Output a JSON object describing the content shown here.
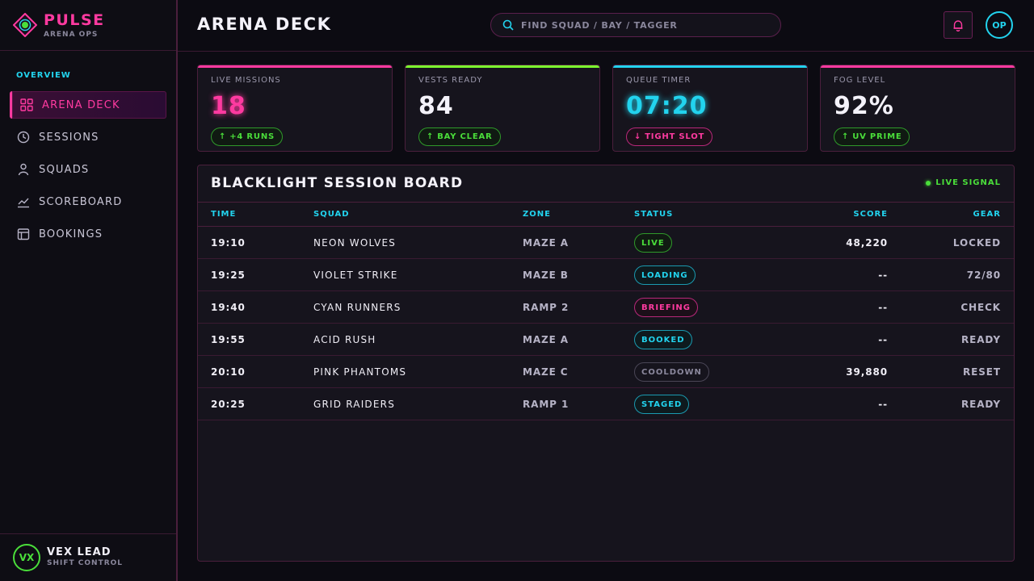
{
  "brand": {
    "name": "PULSE",
    "subtitle": "ARENA OPS"
  },
  "sidebar": {
    "section_label": "OVERVIEW",
    "items": [
      {
        "label": "ARENA DECK",
        "icon": "grid-icon",
        "active": true
      },
      {
        "label": "SESSIONS",
        "icon": "clock-icon",
        "active": false
      },
      {
        "label": "SQUADS",
        "icon": "person-icon",
        "active": false
      },
      {
        "label": "SCOREBOARD",
        "icon": "chart-line-icon",
        "active": false
      },
      {
        "label": "BOOKINGS",
        "icon": "calendar-icon",
        "active": false
      }
    ]
  },
  "user": {
    "initials": "VX",
    "name": "VEX LEAD",
    "role": "SHIFT CONTROL"
  },
  "header": {
    "title": "ARENA DECK",
    "search_placeholder": "FIND SQUAD / BAY / TAGGER",
    "profile_initials": "OP"
  },
  "stats": [
    {
      "label": "LIVE MISSIONS",
      "value": "18",
      "badge": "+4 RUNS",
      "direction": "up",
      "accent": "#ff3aa0"
    },
    {
      "label": "VESTS READY",
      "value": "84",
      "badge": "BAY CLEAR",
      "direction": "up",
      "accent": "#7dff2e"
    },
    {
      "label": "QUEUE TIMER",
      "value": "07:20",
      "badge": "TIGHT SLOT",
      "direction": "down",
      "accent": "#22d3ee"
    },
    {
      "label": "FOG LEVEL",
      "value": "92%",
      "badge": "UV PRIME",
      "direction": "up",
      "accent": "#ff3aa0"
    }
  ],
  "board": {
    "title": "BLACKLIGHT SESSION BOARD",
    "signal": "LIVE SIGNAL",
    "columns": {
      "time": "TIME",
      "squad": "SQUAD",
      "zone": "ZONE",
      "status": "STATUS",
      "score": "SCORE",
      "gear": "GEAR"
    },
    "rows": [
      {
        "time": "19:10",
        "squad": "NEON WOLVES",
        "zone": "MAZE A",
        "status": "LIVE",
        "status_tone": "live",
        "score": "48,220",
        "gear": "LOCKED"
      },
      {
        "time": "19:25",
        "squad": "VIOLET STRIKE",
        "zone": "MAZE B",
        "status": "LOADING",
        "status_tone": "cyan",
        "score": "--",
        "gear": "72/80"
      },
      {
        "time": "19:40",
        "squad": "CYAN RUNNERS",
        "zone": "RAMP 2",
        "status": "BRIEFING",
        "status_tone": "pink",
        "score": "--",
        "gear": "CHECK"
      },
      {
        "time": "19:55",
        "squad": "ACID RUSH",
        "zone": "MAZE A",
        "status": "BOOKED",
        "status_tone": "cyan",
        "score": "--",
        "gear": "READY"
      },
      {
        "time": "20:10",
        "squad": "PINK PHANTOMS",
        "zone": "MAZE C",
        "status": "COOLDOWN",
        "status_tone": "grey",
        "score": "39,880",
        "gear": "RESET"
      },
      {
        "time": "20:25",
        "squad": "GRID RAIDERS",
        "zone": "RAMP 1",
        "status": "STAGED",
        "status_tone": "cyan",
        "score": "--",
        "gear": "READY"
      }
    ]
  },
  "colors": {
    "pink": "#ff3aa0",
    "cyan": "#22d3ee",
    "green": "#4ade3a",
    "lime": "#7dff2e",
    "background": "#0c0b12"
  }
}
